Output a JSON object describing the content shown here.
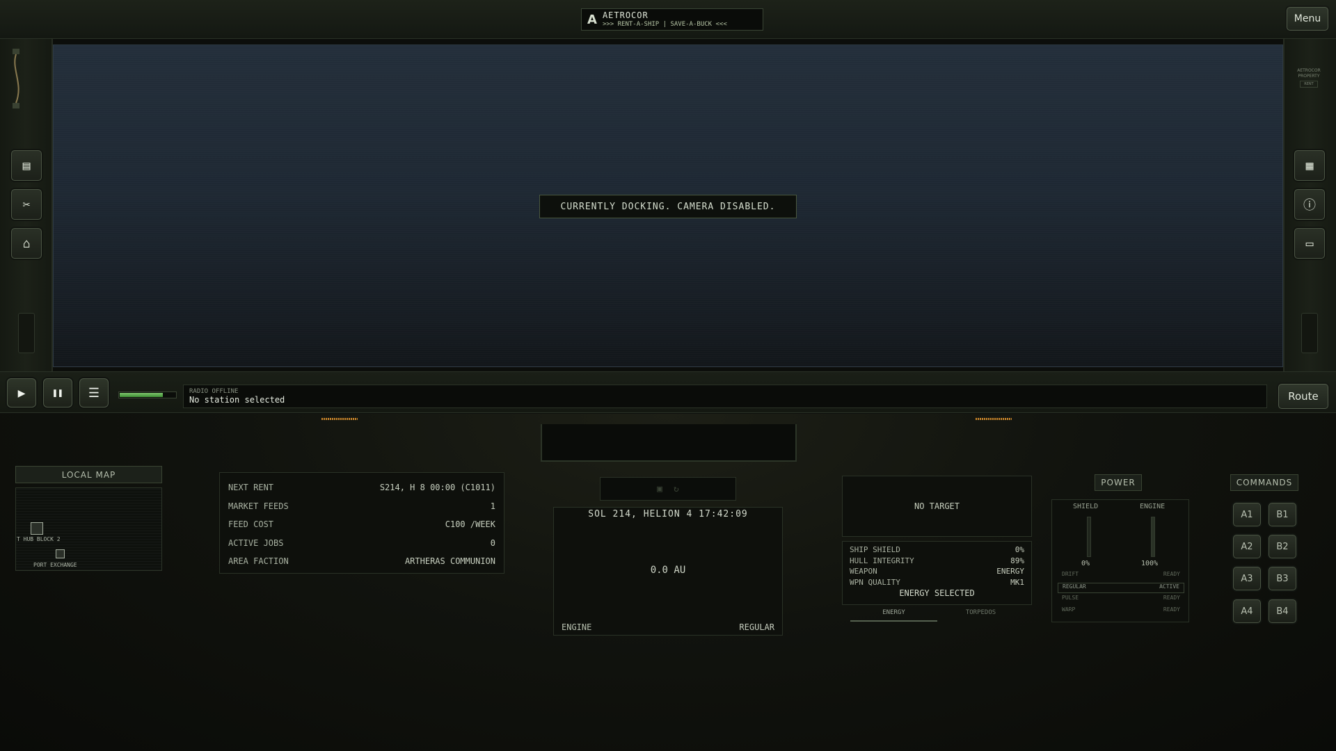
{
  "brand": {
    "logo_glyph": "A",
    "title": "AETROCOR",
    "tagline": ">>> RENT-A-SHIP | SAVE-A-BUCK <<<"
  },
  "menu_label": "Menu",
  "property_tag": {
    "line1": "AETROCOR",
    "line2": "PROPERTY",
    "line3": "RENT"
  },
  "left_sidebar": [
    {
      "icon": "clipboard-icon",
      "glyph": "▤"
    },
    {
      "icon": "tools-icon",
      "glyph": "✂"
    },
    {
      "icon": "shop-icon",
      "glyph": "⌂"
    }
  ],
  "right_sidebar": [
    {
      "icon": "calendar-icon",
      "glyph": "▦"
    },
    {
      "icon": "info-icon",
      "glyph": "ⓘ"
    },
    {
      "icon": "chat-icon",
      "glyph": "▭"
    }
  ],
  "viewport_message": "CURRENTLY DOCKING. CAMERA DISABLED.",
  "controls": {
    "play_glyph": "▶",
    "pause_glyph": "❚❚",
    "list_glyph": "☰",
    "power_level": 0.78
  },
  "radio": {
    "status": "RADIO OFFLINE",
    "message": "No station selected"
  },
  "route_label": "Route",
  "local_map": {
    "title": "LOCAL MAP",
    "nodes": [
      {
        "label": "T HUB BLOCK 2"
      },
      {
        "label": "PORT EXCHANGE"
      }
    ]
  },
  "station_info": [
    {
      "label": "NEXT RENT",
      "value": "S214, H 8 00:00 (C1011)"
    },
    {
      "label": "MARKET FEEDS",
      "value": "1"
    },
    {
      "label": "FEED COST",
      "value": "C100 /WEEK"
    },
    {
      "label": "ACTIVE JOBS",
      "value": "0"
    },
    {
      "label": "AREA FACTION",
      "value": "ARTHERAS COMMUNION"
    }
  ],
  "nav": {
    "datetime": "SOL 214, HELION 4 17:42:09",
    "distance": "0.0 AU",
    "engine_label": "ENGINE",
    "engine_mode": "REGULAR"
  },
  "target": {
    "label": "NO TARGET",
    "stats": [
      {
        "label": "SHIP SHIELD",
        "value": "0%"
      },
      {
        "label": "HULL INTEGRITY",
        "value": "89%"
      },
      {
        "label": "WEAPON",
        "value": "ENERGY"
      },
      {
        "label": "WPN QUALITY",
        "value": "MK1"
      }
    ],
    "selected": "ENERGY SELECTED",
    "tabs": [
      "ENERGY",
      "TORPEDOS"
    ]
  },
  "power": {
    "title": "POWER",
    "shield_label": "SHIELD",
    "engine_label": "ENGINE",
    "shield_value": "0%",
    "engine_value": "100%",
    "modes": [
      {
        "name": "DRIFT",
        "status": "READY"
      },
      {
        "name": "REGULAR",
        "status": "ACTIVE"
      },
      {
        "name": "PULSE",
        "status": "READY"
      },
      {
        "name": "WARP",
        "status": "READY"
      }
    ]
  },
  "commands": {
    "title": "COMMANDS",
    "buttons": [
      "A1",
      "B1",
      "A2",
      "B2",
      "A3",
      "B3",
      "A4",
      "B4"
    ]
  },
  "colors": {
    "accent_green": "#7ec46d",
    "amber": "#c9852a",
    "panel_bg": "#0e100c"
  }
}
